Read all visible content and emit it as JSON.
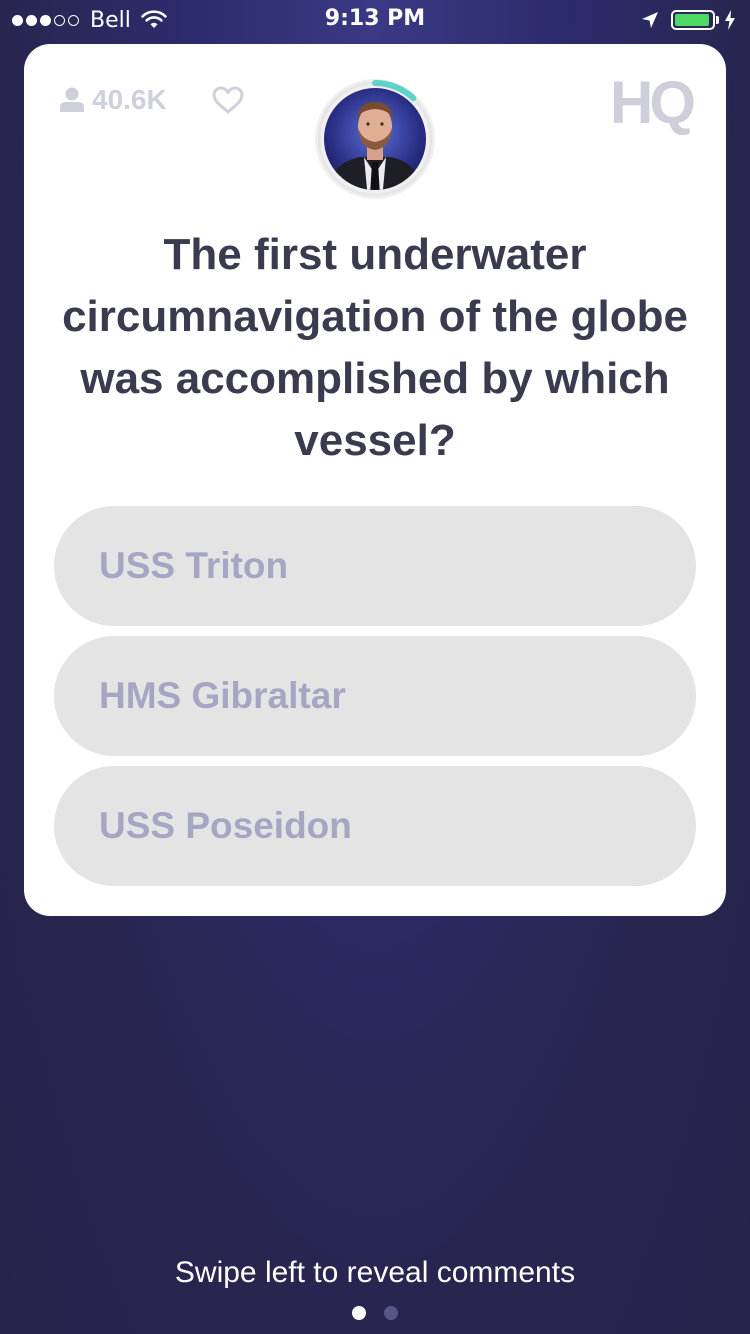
{
  "status_bar": {
    "carrier": "Bell",
    "time": "9:13 PM",
    "signal_bars": [
      true,
      true,
      true,
      false,
      false
    ],
    "battery_color": "#4cd964",
    "battery_level": 0.95
  },
  "game": {
    "viewer_count": "40.6K",
    "logo": "HQ",
    "timer_progress": 0.12,
    "timer_color": "#5fd3c8",
    "question": "The first underwater circumnavigation of the globe was accomplished by which vessel?",
    "answers": [
      {
        "label": "USS Triton"
      },
      {
        "label": "HMS Gibraltar"
      },
      {
        "label": "USS Poseidon"
      }
    ]
  },
  "footer": {
    "swipe_hint": "Swipe left to reveal comments",
    "page_count": 2,
    "active_page": 1
  },
  "icons": {
    "viewer": "person-icon",
    "like": "heart-icon",
    "wifi": "wifi-icon",
    "location": "location-arrow-icon",
    "charging": "bolt-icon"
  }
}
